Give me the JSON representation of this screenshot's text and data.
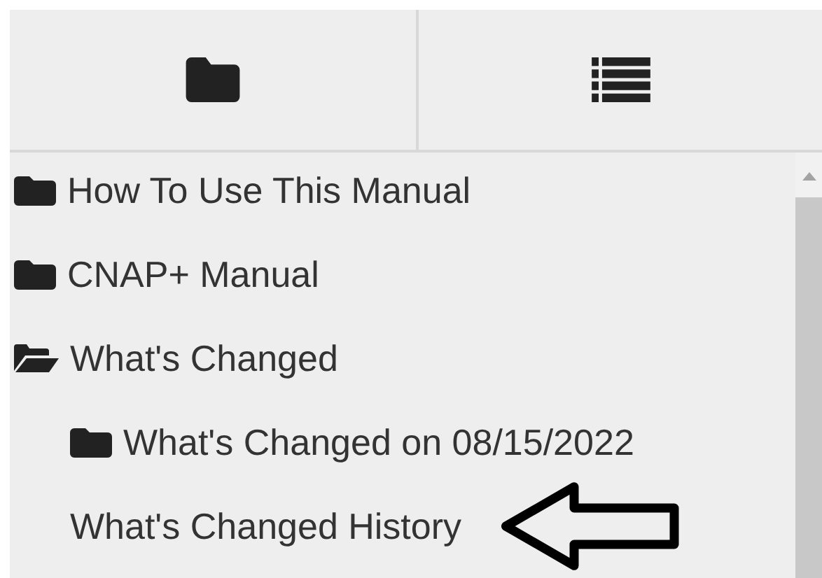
{
  "view_tabs": [
    {
      "kind": "folder"
    },
    {
      "kind": "list"
    }
  ],
  "tree": [
    {
      "label": "How To Use This Manual",
      "kind": "folder",
      "expanded": false
    },
    {
      "label": "CNAP+ Manual",
      "kind": "folder",
      "expanded": false
    },
    {
      "label": "What's Changed",
      "kind": "folder",
      "expanded": true,
      "children": [
        {
          "label": "What's Changed on 08/15/2022",
          "kind": "folder",
          "expanded": false
        },
        {
          "label": "What's Changed History",
          "kind": "page",
          "pointed": true
        }
      ]
    }
  ]
}
